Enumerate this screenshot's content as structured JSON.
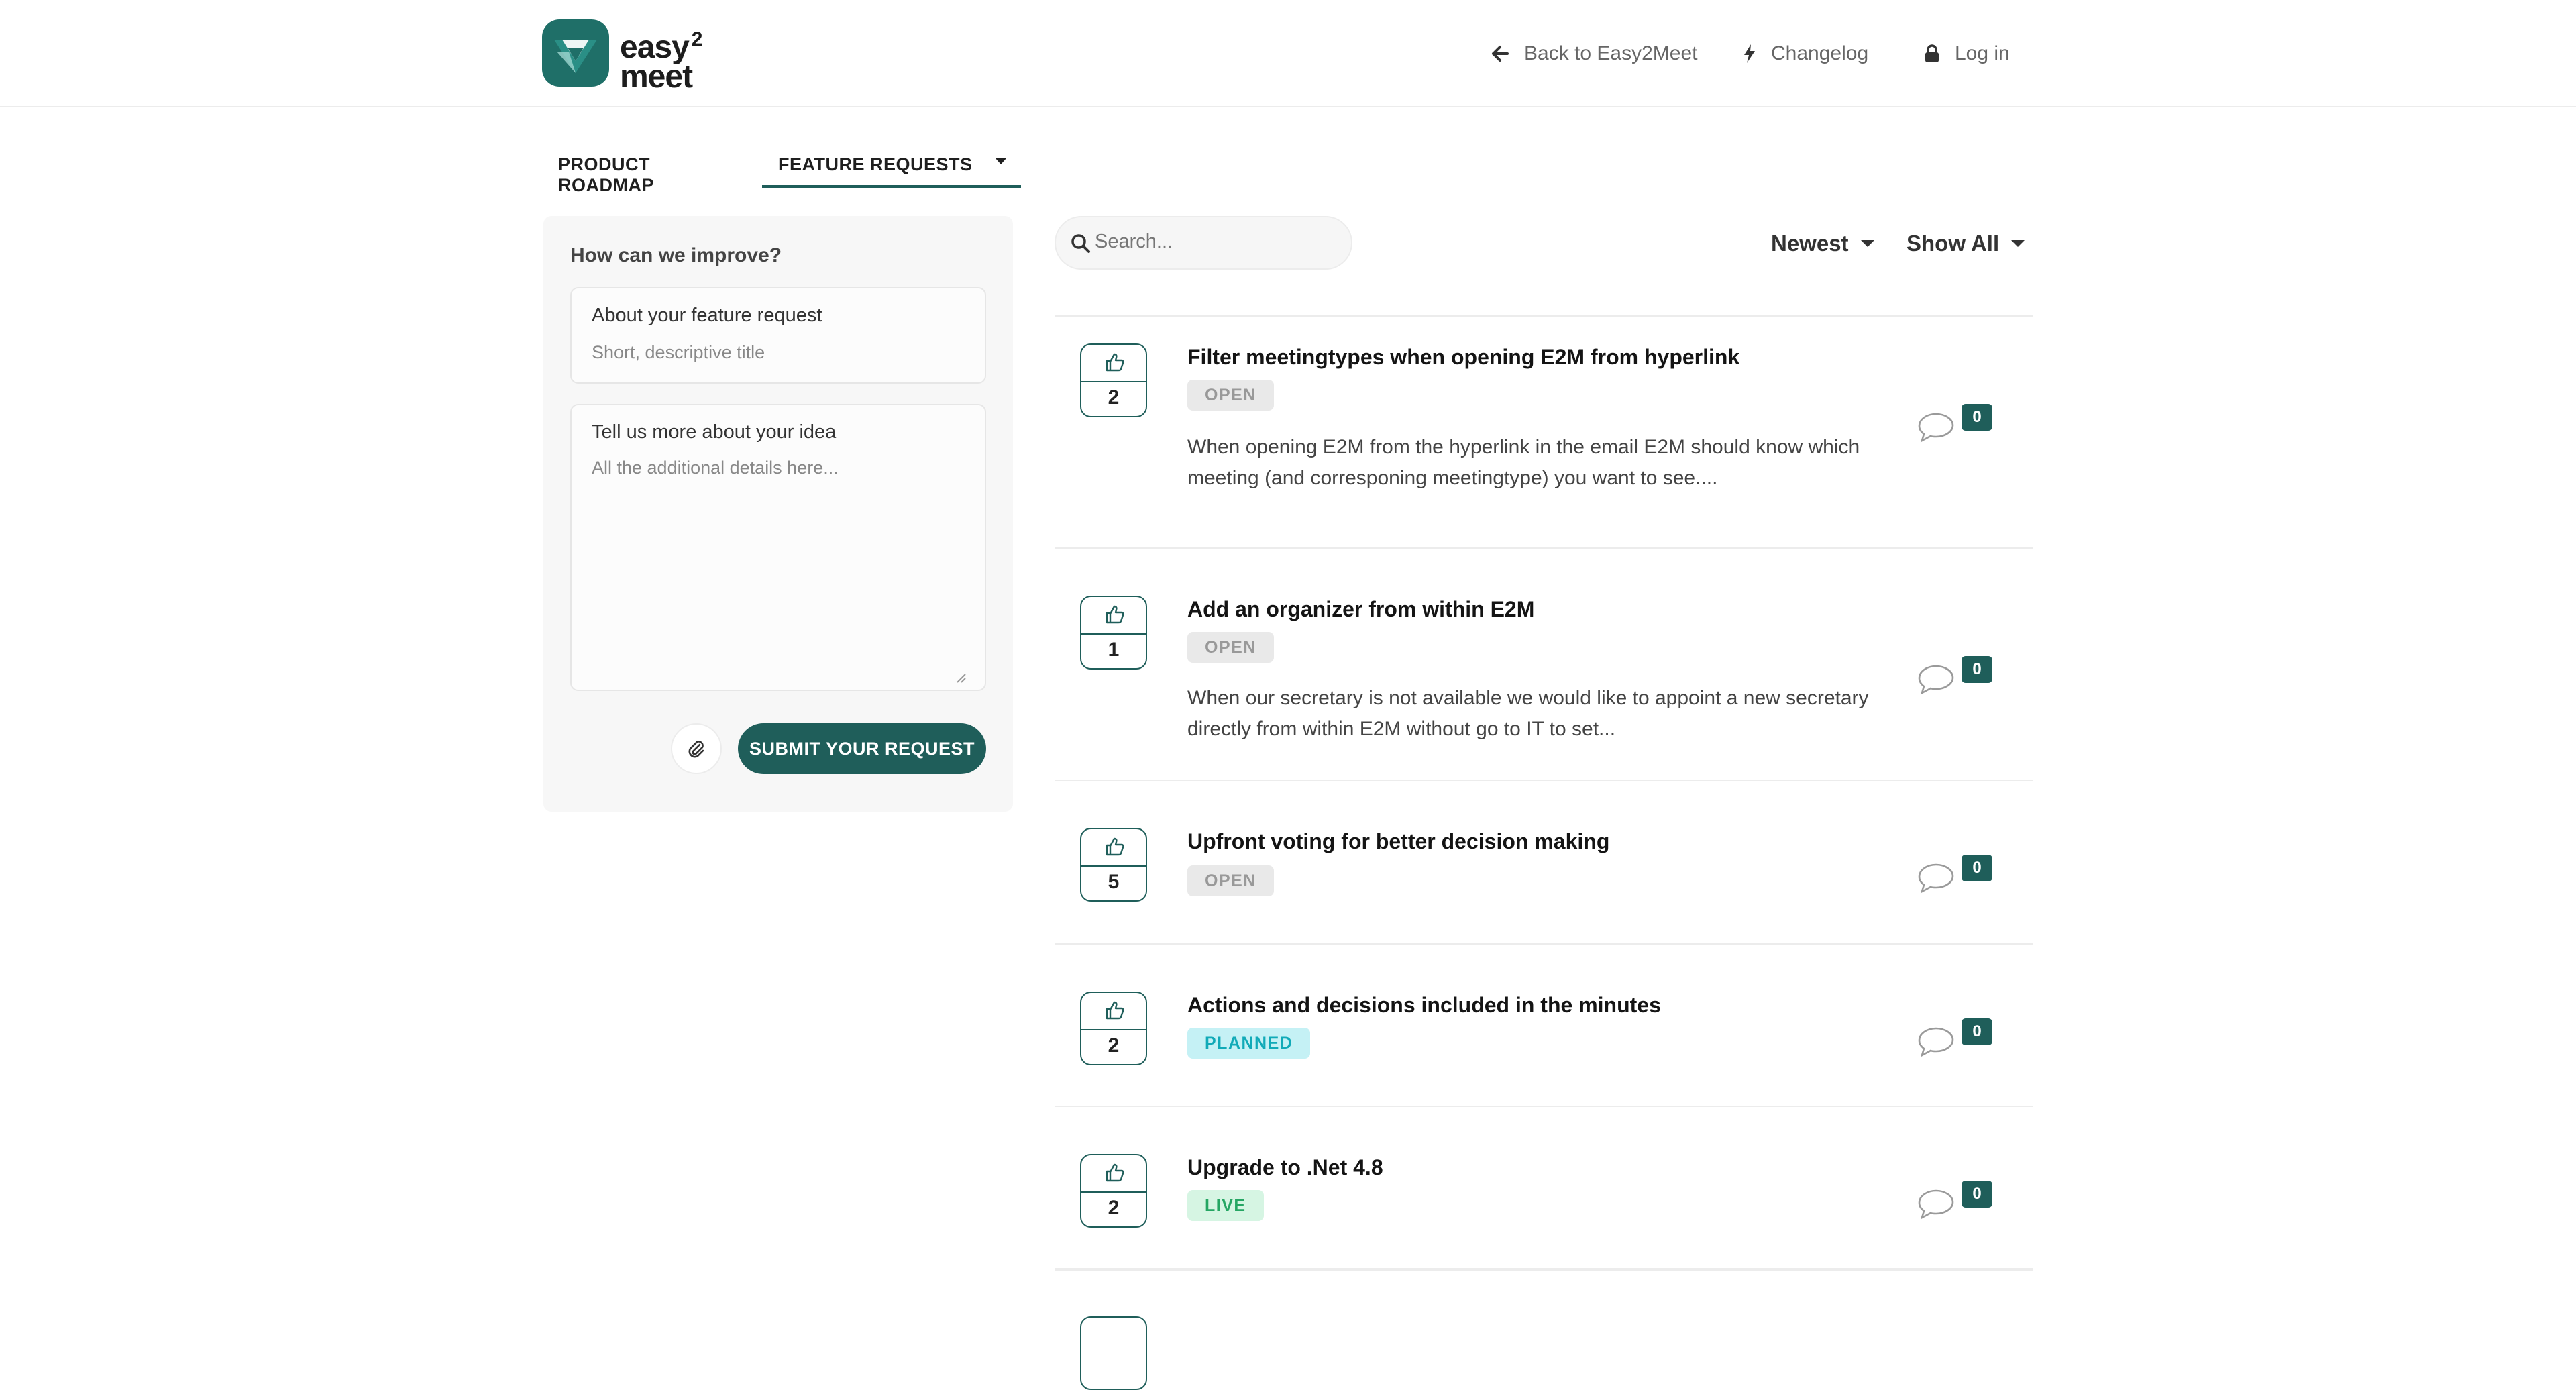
{
  "brand": {
    "name": "easy",
    "superscript": "2",
    "name_line2": "meet"
  },
  "header": {
    "back_label": "Back to Easy2Meet",
    "changelog_label": "Changelog",
    "login_label": "Log in"
  },
  "tabs": [
    {
      "label": "PRODUCT ROADMAP"
    },
    {
      "label": "FEATURE REQUESTS"
    }
  ],
  "form": {
    "title": "How can we improve?",
    "feature_label": "About your feature request",
    "feature_placeholder": "Short, descriptive title",
    "idea_label": "Tell us more about your idea",
    "idea_placeholder": "All the additional details here...",
    "submit_label": "SUBMIT YOUR REQUEST"
  },
  "toolbar": {
    "search_placeholder": "Search...",
    "sort_label": "Newest",
    "filter_label": "Show All"
  },
  "colors": {
    "accent": "#1f5e5a",
    "open_badge_bg": "#e9e9e9",
    "planned_badge_bg": "#c5f1f5",
    "live_badge_bg": "#d6f5e3"
  },
  "requests": [
    {
      "votes": "2",
      "title": "Filter meetingtypes when opening E2M from hyperlink",
      "status": "OPEN",
      "description": "When opening E2M from the hyperlink in the email E2M should know which meeting (and corresponing meetingtype) you want to see....",
      "comments": "0"
    },
    {
      "votes": "1",
      "title": "Add an organizer from within E2M",
      "status": "OPEN",
      "description": "When our secretary is not available we would like to appoint a new secretary directly from within E2M without go to IT to set...",
      "comments": "0"
    },
    {
      "votes": "5",
      "title": "Upfront voting for better decision making",
      "status": "OPEN",
      "comments": "0"
    },
    {
      "votes": "2",
      "title": "Actions and decisions included in the minutes",
      "status": "PLANNED",
      "comments": "0"
    },
    {
      "votes": "2",
      "title": "Upgrade to .Net 4.8",
      "status": "LIVE",
      "comments": "0"
    }
  ]
}
